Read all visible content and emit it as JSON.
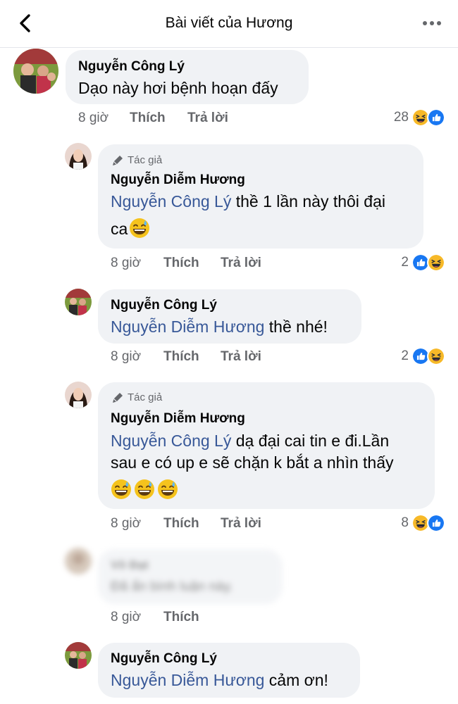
{
  "header": {
    "title": "Bài viết của Hương"
  },
  "comments": [
    {
      "name": "Nguyễn Công Lý",
      "text": "Dạo này hơi bệnh hoạn đấy",
      "time": "8 giờ",
      "like": "Thích",
      "reply": "Trả lời",
      "reaction_count": "28"
    },
    {
      "author_tag": "Tác giả",
      "name": "Nguyễn Diễm Hương",
      "mention": "Nguyễn Công Lý",
      "text_line1": " thề 1 lần này thôi đại",
      "text_line2": "ca",
      "time": "8 giờ",
      "like": "Thích",
      "reply": "Trả lời",
      "reaction_count": "2"
    },
    {
      "name": "Nguyễn Công Lý",
      "mention": "Nguyễn Diễm Hương",
      "text": " thề nhé!",
      "time": "8 giờ",
      "like": "Thích",
      "reply": "Trả lời",
      "reaction_count": "2"
    },
    {
      "author_tag": "Tác giả",
      "name": "Nguyễn Diễm Hương",
      "mention": "Nguyễn Công Lý",
      "text_line1": " dạ đại cai tin e đi.Lần",
      "text_line2": "sau e có up e sẽ chặn k bắt a nhìn thấy",
      "time": "8 giờ",
      "like": "Thích",
      "reply": "Trả lời",
      "reaction_count": "8"
    },
    {
      "name": "Võ Đạt",
      "text": "Đã ẩn bình luận này.",
      "time": "8 giờ",
      "like": "Thích"
    },
    {
      "name": "Nguyễn Công Lý",
      "mention": "Nguyễn Diễm Hương",
      "text": " cảm ơn!"
    }
  ],
  "colors": {
    "mention": "#385898",
    "bubble": "#f0f2f5",
    "meta": "#65676b",
    "like_blue": "#1877f2",
    "haha_yellow": "#f7b928"
  },
  "icons": [
    "back-arrow-icon",
    "more-icon",
    "pencil-icon",
    "like-reaction-icon",
    "haha-reaction-icon",
    "sweat-smile-emoji"
  ]
}
